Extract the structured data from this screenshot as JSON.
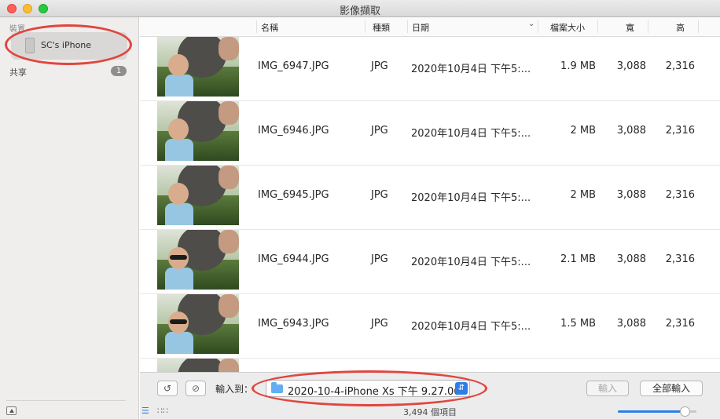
{
  "window": {
    "title": "影像擷取"
  },
  "sidebar": {
    "heading": "裝置",
    "device": {
      "label": "SC's iPhone"
    },
    "shared": {
      "label": "共享",
      "badge": "1"
    }
  },
  "table": {
    "columns": {
      "name": "名稱",
      "kind": "種類",
      "date": "日期",
      "size": "檔案大小",
      "width": "寬",
      "height": "高"
    },
    "rows": [
      {
        "name": "IMG_6947.JPG",
        "kind": "JPG",
        "date": "2020年10月4日 下午5:...",
        "size": "1.9 MB",
        "width": "3,088",
        "height": "2,316"
      },
      {
        "name": "IMG_6946.JPG",
        "kind": "JPG",
        "date": "2020年10月4日 下午5:...",
        "size": "2 MB",
        "width": "3,088",
        "height": "2,316"
      },
      {
        "name": "IMG_6945.JPG",
        "kind": "JPG",
        "date": "2020年10月4日 下午5:...",
        "size": "2 MB",
        "width": "3,088",
        "height": "2,316"
      },
      {
        "name": "IMG_6944.JPG",
        "kind": "JPG",
        "date": "2020年10月4日 下午5:...",
        "size": "2.1 MB",
        "width": "3,088",
        "height": "2,316"
      },
      {
        "name": "IMG_6943.JPG",
        "kind": "JPG",
        "date": "2020年10月4日 下午5:...",
        "size": "1.5 MB",
        "width": "3,088",
        "height": "2,316"
      }
    ]
  },
  "toolbar": {
    "import_to_label": "輸入到：",
    "destination": "2020-10-4-iPhone Xs 下午 9.27.06",
    "import_label": "輸入",
    "import_all_label": "全部輸入"
  },
  "status": {
    "item_count": "3,494 個項目",
    "zoom_level": 0.85
  },
  "colors": {
    "accent": "#2f7de8",
    "annotation": "#e0463f"
  }
}
